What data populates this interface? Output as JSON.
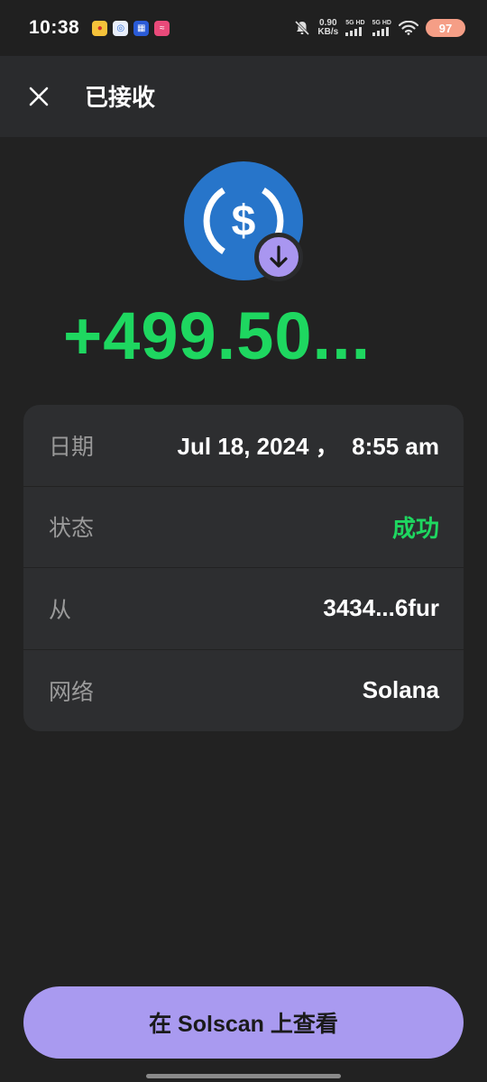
{
  "status_bar": {
    "time": "10:38",
    "net_speed_value": "0.90",
    "net_speed_unit": "KB/s",
    "sim1_label": "5G HD",
    "sim2_label": "5G HD",
    "battery": "97",
    "icons": [
      "weibo-icon",
      "mesh-app-icon",
      "grid-app-icon",
      "wave-app-icon",
      "mute-icon",
      "wifi-icon"
    ]
  },
  "header": {
    "title": "已接收",
    "close_icon": "close-icon"
  },
  "token": {
    "icon": "usdc-icon",
    "badge_icon": "arrow-down-icon",
    "colors": {
      "token_bg": "#2775ca",
      "badge_bg": "#a996f0"
    }
  },
  "amount": "+499.50...",
  "details": [
    {
      "label": "日期",
      "value": "Jul 18, 2024 ，  8:55 am"
    },
    {
      "label": "状态",
      "value": "成功"
    },
    {
      "label": "从",
      "value": "3434...6fur"
    },
    {
      "label": "网络",
      "value": "Solana"
    }
  ],
  "actions": {
    "view_button": "在 Solscan 上查看"
  },
  "colors": {
    "background": "#222222",
    "header_bg": "#2a2b2d",
    "card_bg": "#2d2e30",
    "success": "#1ed760",
    "accent": "#a99af0"
  }
}
